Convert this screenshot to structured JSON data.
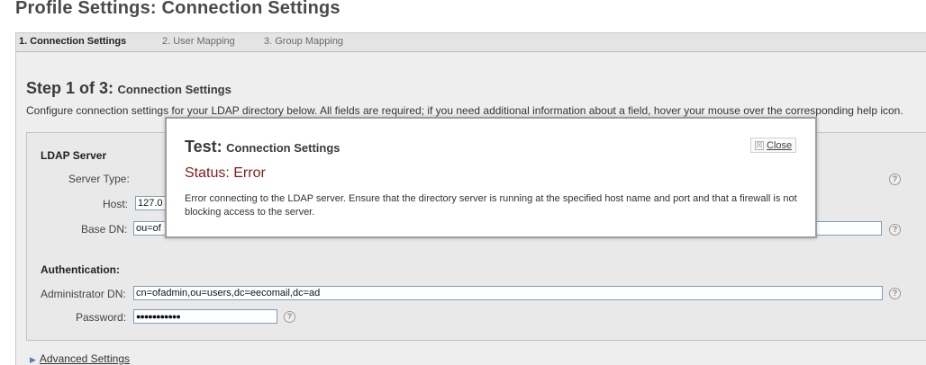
{
  "page": {
    "title": "Profile Settings: Connection Settings"
  },
  "tabs": [
    {
      "label": "1. Connection Settings",
      "active": true
    },
    {
      "label": "2. User Mapping",
      "active": false
    },
    {
      "label": "3. Group Mapping",
      "active": false
    }
  ],
  "step": {
    "title_big": "Step 1 of 3:",
    "title_small": "Connection Settings",
    "description": "Configure connection settings for your LDAP directory below. All fields are required; if you need additional information about a field, hover your mouse over the corresponding help icon."
  },
  "ldap": {
    "heading": "LDAP Server",
    "server_type_label": "Server Type:",
    "host_label": "Host:",
    "host_value": "127.0",
    "base_dn_label": "Base DN:",
    "base_dn_value": "ou=of"
  },
  "auth": {
    "heading": "Authentication:",
    "admin_dn_label": "Administrator DN:",
    "admin_dn_value": "cn=ofadmin,ou=users,dc=eecomail,dc=ad",
    "password_label": "Password:",
    "password_value": "●●●●●●●●●●●"
  },
  "advanced": {
    "label": "Advanced Settings"
  },
  "help_icon": {
    "glyph": "?"
  },
  "dialog": {
    "title_big": "Test:",
    "title_small": "Connection Settings",
    "status": "Status: Error",
    "message": "Error connecting to the LDAP server. Ensure that the directory server is running at the specified host name and port and that a firewall is not blocking access to the server.",
    "close_label": "Close",
    "close_icon": "☒"
  },
  "colors": {
    "status_error": "#8a1a1a",
    "input_border": "#7f9db9"
  }
}
